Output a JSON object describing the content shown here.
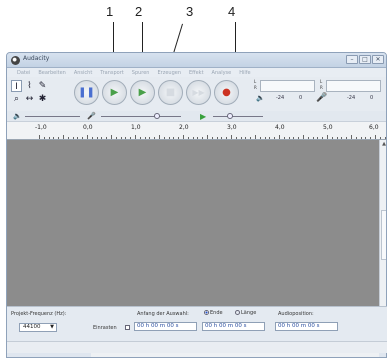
{
  "callouts": [
    "1",
    "2",
    "3",
    "4"
  ],
  "window": {
    "title": "Audacity",
    "controls": [
      "–",
      "□",
      "✕"
    ]
  },
  "menu": [
    "Datei",
    "Bearbeiten",
    "Ansicht",
    "Transport",
    "Spuren",
    "Erzeugen",
    "Effekt",
    "Analyse",
    "Hilfe"
  ],
  "tools": [
    "I",
    "⌇",
    "✎",
    "⌕",
    "↔",
    "✱"
  ],
  "transport": {
    "pause": "❚❚",
    "play": "▶",
    "loop": "▶",
    "stop": "■",
    "skip_end": "▶▶",
    "record": "●"
  },
  "meters": {
    "left_label": "L",
    "right_label": "R",
    "scale": [
      "-24",
      "0",
      "-24",
      "0"
    ]
  },
  "ruler": {
    "labels": [
      "-1,0",
      "0,0",
      "1,0",
      "2,0",
      "3,0",
      "4,0",
      "5,0",
      "6,0"
    ]
  },
  "selection_bar": {
    "rate_label": "Projekt-Frequenz (Hz):",
    "rate_value": "44100",
    "snap_label": "Einrasten",
    "start_label": "Anfang der Auswahl:",
    "end_label": "Ende",
    "length_label": "Länge",
    "position_label": "Audioposition:",
    "start_value": "00 h 00 m 00 s",
    "end_value": "00 h 00 m 00 s",
    "position_value": "00 h 00 m 00 s"
  }
}
